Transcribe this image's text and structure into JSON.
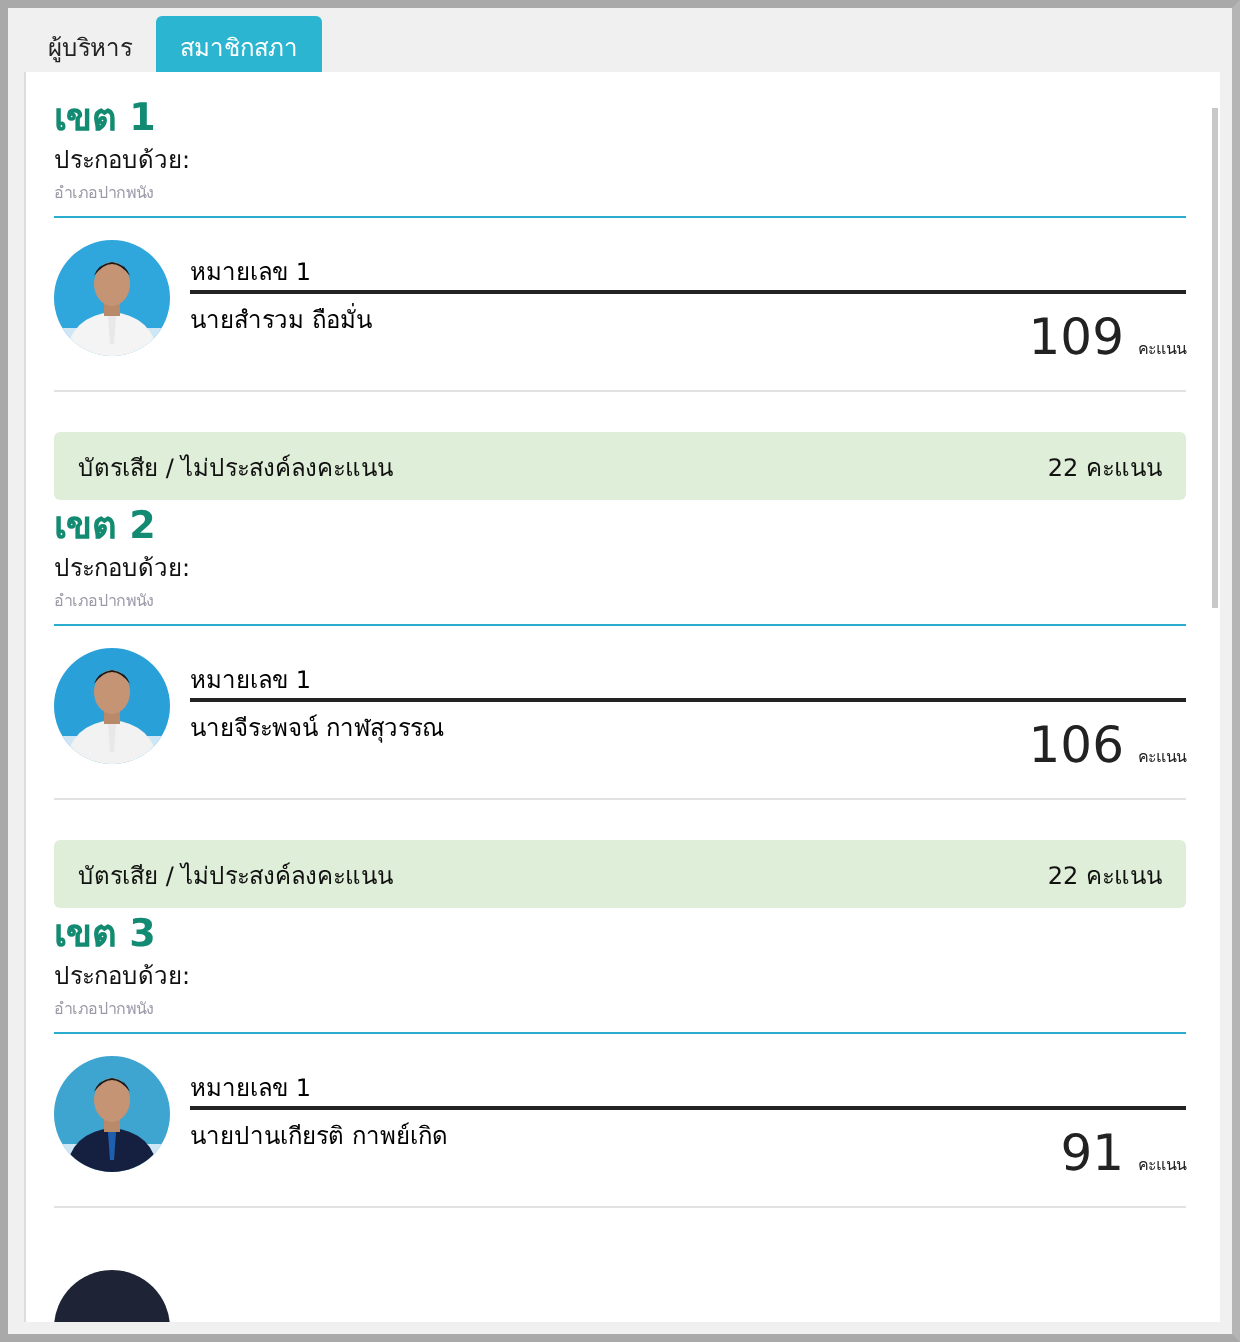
{
  "tabs": [
    {
      "label": "ผู้บริหาร",
      "selected": false
    },
    {
      "label": "สมาชิกสภา",
      "selected": true
    }
  ],
  "districts": [
    {
      "title": "เขต 1",
      "consists_label": "ประกอบด้วย:",
      "area": "อำเภอปากพนัง",
      "candidates": [
        {
          "number": "หมายเลข 1",
          "name": "นายสำรวม ถือมั่น",
          "score": "109",
          "unit": "คะแนน"
        }
      ],
      "invalid": {
        "label": "บัตรเสีย / ไม่ประสงค์ลงคะแนน",
        "value": "22 คะแนน"
      }
    },
    {
      "title": "เขต 2",
      "consists_label": "ประกอบด้วย:",
      "area": "อำเภอปากพนัง",
      "candidates": [
        {
          "number": "หมายเลข 1",
          "name": "นายจีระพจน์ กาฬสุวรรณ",
          "score": "106",
          "unit": "คะแนน"
        }
      ],
      "invalid": {
        "label": "บัตรเสีย / ไม่ประสงค์ลงคะแนน",
        "value": "22 คะแนน"
      }
    },
    {
      "title": "เขต 3",
      "consists_label": "ประกอบด้วย:",
      "area": "อำเภอปากพนัง",
      "candidates": [
        {
          "number": "หมายเลข 1",
          "name": "นายปานเกียรติ กาพย์เกิด",
          "score": "91",
          "unit": "คะแนน"
        },
        {
          "kind": "picture"
        }
      ]
    }
  ]
}
